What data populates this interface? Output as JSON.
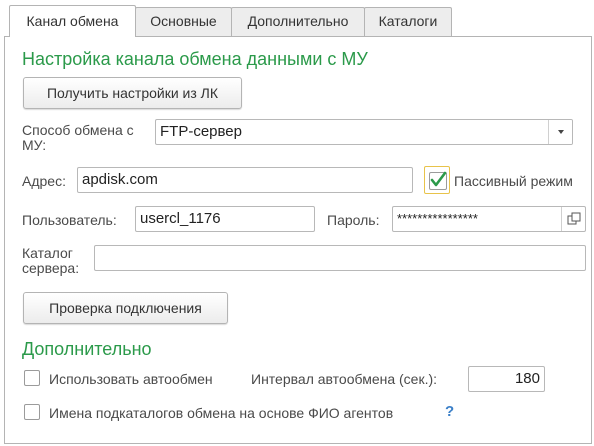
{
  "tabs": [
    {
      "label": "Канал обмена",
      "active": true
    },
    {
      "label": "Основные"
    },
    {
      "label": "Дополнительно"
    },
    {
      "label": "Каталоги"
    }
  ],
  "section_title": "Настройка канала обмена данными с МУ",
  "get_settings_button": "Получить настройки из ЛК",
  "exchange_method": {
    "label_line1": "Способ обмена с",
    "label_line2": "МУ:",
    "value": "FTP-сервер"
  },
  "address": {
    "label": "Адрес:",
    "value": "apdisk.com"
  },
  "passive_mode": {
    "label": "Пассивный режим",
    "checked": true
  },
  "user": {
    "label": "Пользователь:",
    "value": "usercl_1176"
  },
  "password": {
    "label": "Пароль:",
    "value": "****************"
  },
  "server_catalog": {
    "label_line1": "Каталог",
    "label_line2": "сервера:",
    "value": ""
  },
  "check_connection_button": "Проверка подключения",
  "additional_title": "Дополнительно",
  "auto_exchange": {
    "label": "Использовать автообмен",
    "checked": false
  },
  "interval": {
    "label": "Интервал автообмена (сек.):",
    "value": "180"
  },
  "subdir_names": {
    "label": "Имена подкаталогов обмена на основе ФИО агентов",
    "checked": false
  },
  "help_mark": "?",
  "colors": {
    "accent_green": "#2b9a4a",
    "help_blue": "#3a7fc8",
    "focus_yellow": "#e8c34a"
  }
}
